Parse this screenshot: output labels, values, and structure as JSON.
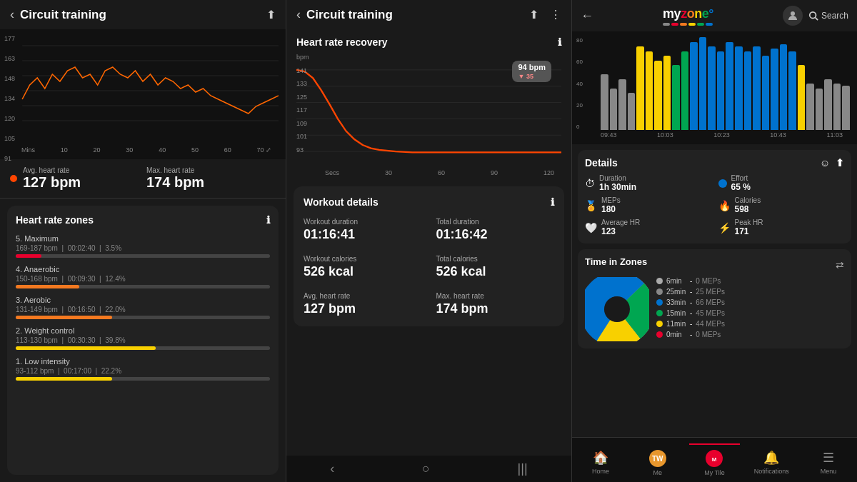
{
  "panel1": {
    "header": {
      "back_label": "‹",
      "title": "Circuit training",
      "share_icon": "share"
    },
    "chart": {
      "y_labels": [
        "177",
        "163",
        "148",
        "134",
        "120",
        "105",
        "91"
      ],
      "x_labels": [
        "Mins",
        "10",
        "20",
        "30",
        "40",
        "50",
        "60",
        "70"
      ],
      "expand_icon": "⤢"
    },
    "stats": {
      "avg_label": "Avg. heart rate",
      "avg_value": "127 bpm",
      "avg_color": "#ff4500",
      "max_label": "Max. heart rate",
      "max_value": "174 bpm"
    },
    "zones": {
      "title": "Heart rate zones",
      "info_icon": "ℹ",
      "items": [
        {
          "number": "5.",
          "name": "Maximum",
          "range": "169-187 bpm",
          "duration": "00:02:40",
          "percent": "3.5%",
          "fill_width": 10,
          "color": "#e8002d"
        },
        {
          "number": "4.",
          "name": "Anaerobic",
          "range": "150-168 bpm",
          "duration": "00:09:30",
          "percent": "12.4%",
          "fill_width": 25,
          "color": "#f47920"
        },
        {
          "number": "3.",
          "name": "Aerobic",
          "range": "131-149 bpm",
          "duration": "00:16:50",
          "percent": "22.0%",
          "fill_width": 38,
          "color": "#f47920"
        },
        {
          "number": "2.",
          "name": "Weight control",
          "range": "113-130 bpm",
          "duration": "00:30:30",
          "percent": "39.8%",
          "fill_width": 55,
          "color": "#f8d000"
        },
        {
          "number": "1.",
          "name": "Low intensity",
          "range": "93-112 bpm",
          "duration": "00:17:00",
          "percent": "22.2%",
          "fill_width": 38,
          "color": "#f8d000"
        }
      ]
    }
  },
  "panel2": {
    "header": {
      "back_label": "‹",
      "title": "Circuit training",
      "share_icon": "⬆",
      "more_icon": "⋮"
    },
    "hrr": {
      "title": "Heart rate recovery",
      "info_icon": "ℹ",
      "bpm_badge": "94 bpm",
      "badge_sub": "▼ 35",
      "y_labels": [
        "bpm",
        "141",
        "133",
        "125",
        "117",
        "109",
        "101",
        "93"
      ],
      "x_labels": [
        "Secs",
        "30",
        "60",
        "90",
        "120"
      ]
    },
    "workout_details": {
      "title": "Workout details",
      "info_icon": "ℹ",
      "fields": [
        {
          "label": "Workout duration",
          "value": "01:16:41"
        },
        {
          "label": "Total duration",
          "value": "01:16:42"
        },
        {
          "label": "Workout calories",
          "value": "526 kcal"
        },
        {
          "label": "Total calories",
          "value": "526 kcal"
        },
        {
          "label": "Avg. heart rate",
          "value": "127 bpm"
        },
        {
          "label": "Max. heart rate",
          "value": "174 bpm"
        }
      ]
    },
    "nav": {
      "back": "‹",
      "home": "○",
      "recent": "|||"
    }
  },
  "panel3": {
    "header": {
      "back_icon": "←",
      "logo_text": "myzone",
      "logo_degree": "°",
      "search_label": "Search"
    },
    "bar_chart": {
      "y_labels": [
        "80",
        "60",
        "40",
        "20",
        "0"
      ],
      "x_labels": [
        "09:43",
        "10:03",
        "10:23",
        "10:43",
        "11:03"
      ],
      "bars": [
        {
          "color": "#888",
          "height": 60
        },
        {
          "color": "#888",
          "height": 45
        },
        {
          "color": "#888",
          "height": 55
        },
        {
          "color": "#888",
          "height": 40
        },
        {
          "color": "#f8d000",
          "height": 90
        },
        {
          "color": "#f8d000",
          "height": 85
        },
        {
          "color": "#f8d000",
          "height": 75
        },
        {
          "color": "#f8d000",
          "height": 80
        },
        {
          "color": "#00a651",
          "height": 70
        },
        {
          "color": "#00a651",
          "height": 85
        },
        {
          "color": "#0072ce",
          "height": 95
        },
        {
          "color": "#0072ce",
          "height": 100
        },
        {
          "color": "#0072ce",
          "height": 90
        },
        {
          "color": "#0072ce",
          "height": 85
        },
        {
          "color": "#0072ce",
          "height": 95
        },
        {
          "color": "#0072ce",
          "height": 90
        },
        {
          "color": "#0072ce",
          "height": 85
        },
        {
          "color": "#0072ce",
          "height": 90
        },
        {
          "color": "#0072ce",
          "height": 80
        },
        {
          "color": "#0072ce",
          "height": 88
        },
        {
          "color": "#0072ce",
          "height": 92
        },
        {
          "color": "#0072ce",
          "height": 85
        },
        {
          "color": "#f8d000",
          "height": 70
        },
        {
          "color": "#888",
          "height": 50
        },
        {
          "color": "#888",
          "height": 45
        },
        {
          "color": "#888",
          "height": 55
        },
        {
          "color": "#888",
          "height": 50
        },
        {
          "color": "#888",
          "height": 48
        }
      ]
    },
    "details": {
      "title": "Details",
      "smiley_icon": "☺",
      "export_icon": "⬆",
      "items_left": [
        {
          "icon": "⏱",
          "label": "Duration",
          "value": "1h 30min"
        },
        {
          "icon": "🏅",
          "label": "MEPs",
          "value": "180"
        },
        {
          "icon": "🤍",
          "label": "Average HR",
          "value": "123"
        }
      ],
      "items_right": [
        {
          "dot_color": "#0072ce",
          "label": "Effort",
          "value": "65 %"
        },
        {
          "icon": "🔥",
          "label": "Calories",
          "value": "598"
        },
        {
          "icon": "⚡",
          "label": "Peak HR",
          "value": "171"
        }
      ]
    },
    "time_in_zones": {
      "title": "Time in Zones",
      "export_icon": "⇄",
      "pie_segments": [
        {
          "color": "#aaa",
          "value": 6,
          "label": "gray"
        },
        {
          "color": "#888",
          "value": 25,
          "label": "darkgray"
        },
        {
          "color": "#0072ce",
          "value": 33,
          "label": "blue"
        },
        {
          "color": "#00a651",
          "value": 15,
          "label": "green"
        },
        {
          "color": "#f8d000",
          "value": 11,
          "label": "yellow"
        },
        {
          "color": "#e8002d",
          "value": 0,
          "label": "red"
        }
      ],
      "legend": [
        {
          "color": "#aaa",
          "time": "6min",
          "meps": "0 MEPs"
        },
        {
          "color": "#888",
          "time": "25min",
          "meps": "25 MEPs"
        },
        {
          "color": "#0072ce",
          "time": "33min",
          "meps": "66 MEPs"
        },
        {
          "color": "#00a651",
          "time": "15min",
          "meps": "45 MEPs"
        },
        {
          "color": "#f8d000",
          "time": "11min",
          "meps": "44 MEPs"
        },
        {
          "color": "#e8002d",
          "time": "0min",
          "meps": "0 MEPs"
        }
      ]
    },
    "bottom_nav": {
      "items": [
        {
          "icon": "🏠",
          "label": "Home",
          "active": false
        },
        {
          "icon": "TW",
          "label": "Me",
          "active": false
        },
        {
          "icon": "M",
          "label": "My Tile",
          "active": false
        },
        {
          "icon": "🔔",
          "label": "Notifications",
          "active": false
        },
        {
          "icon": "☰",
          "label": "Menu",
          "active": false
        }
      ]
    }
  }
}
